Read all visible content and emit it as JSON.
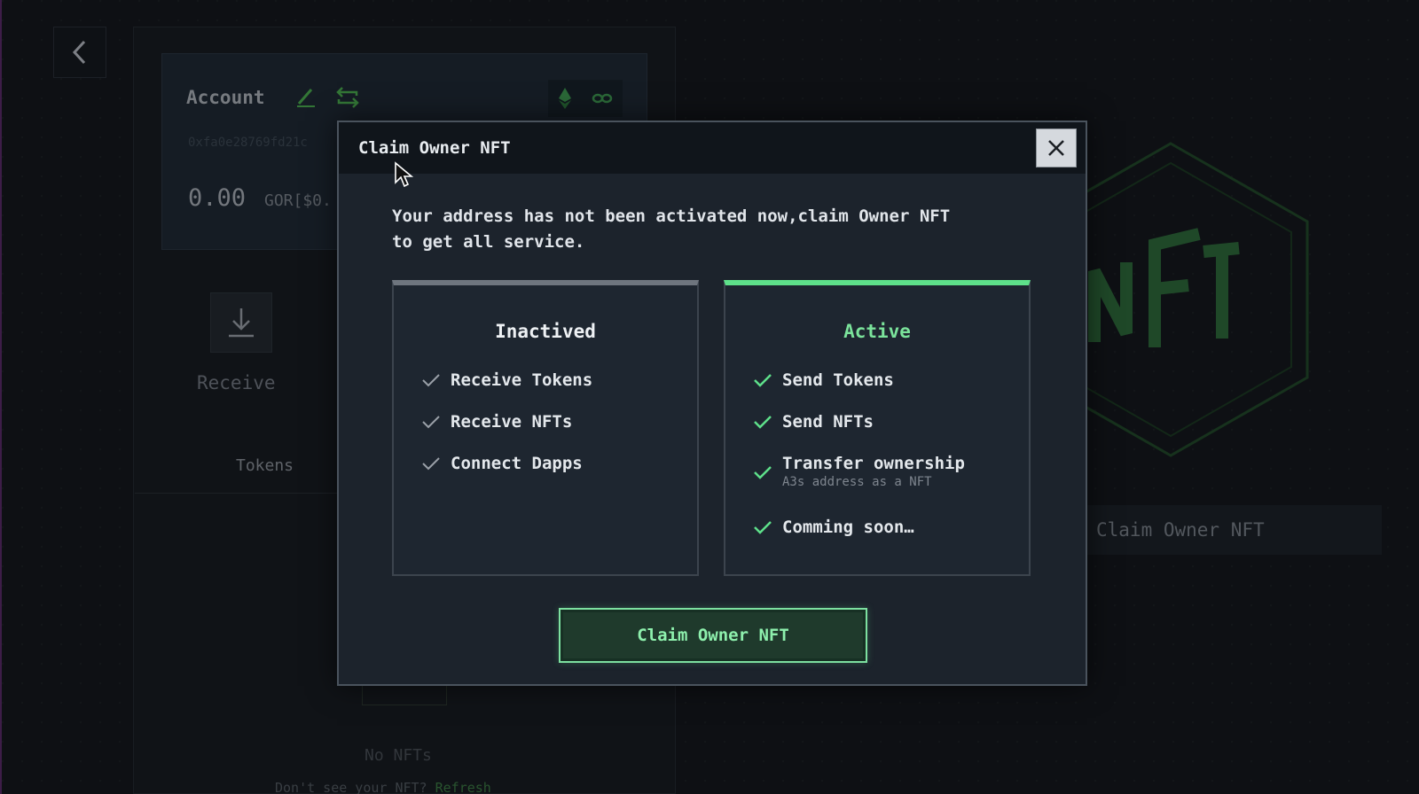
{
  "background": {
    "account": {
      "title": "Account",
      "address": "0xfa0e28769fd21c",
      "balance": "0.00",
      "unit": "GOR[$0."
    },
    "receive_label": "Receive",
    "tokens_tab": "Tokens",
    "no_nfts": "No NFTs",
    "dont_see": "Don't see your NFT?",
    "refresh_link": "Refresh",
    "claim_button": "Claim Owner NFT"
  },
  "modal": {
    "title": "Claim Owner NFT",
    "message_line1": "Your address has not been activated now,claim Owner NFT",
    "message_line2": "to get all service.",
    "inactive": {
      "title": "Inactived",
      "features": [
        "Receive Tokens",
        "Receive NFTs",
        "Connect Dapps"
      ]
    },
    "active": {
      "title": "Active",
      "features": [
        {
          "label": "Send Tokens"
        },
        {
          "label": "Send NFTs"
        },
        {
          "label": "Transfer ownership",
          "sub": "A3s address as a NFT"
        },
        {
          "label": "Comming soon…"
        }
      ]
    },
    "claim_button": "Claim Owner NFT"
  },
  "colors": {
    "accent_green": "#5ee08a",
    "inactive_gray": "#6e757e",
    "modal_bg": "#1c232c",
    "header_bg": "#10151b"
  },
  "icons": [
    "back-arrow-icon",
    "edit-icon",
    "swap-icon",
    "ethereum-icon",
    "link-icon",
    "download-icon",
    "close-icon",
    "check-icon",
    "cursor-icon"
  ]
}
